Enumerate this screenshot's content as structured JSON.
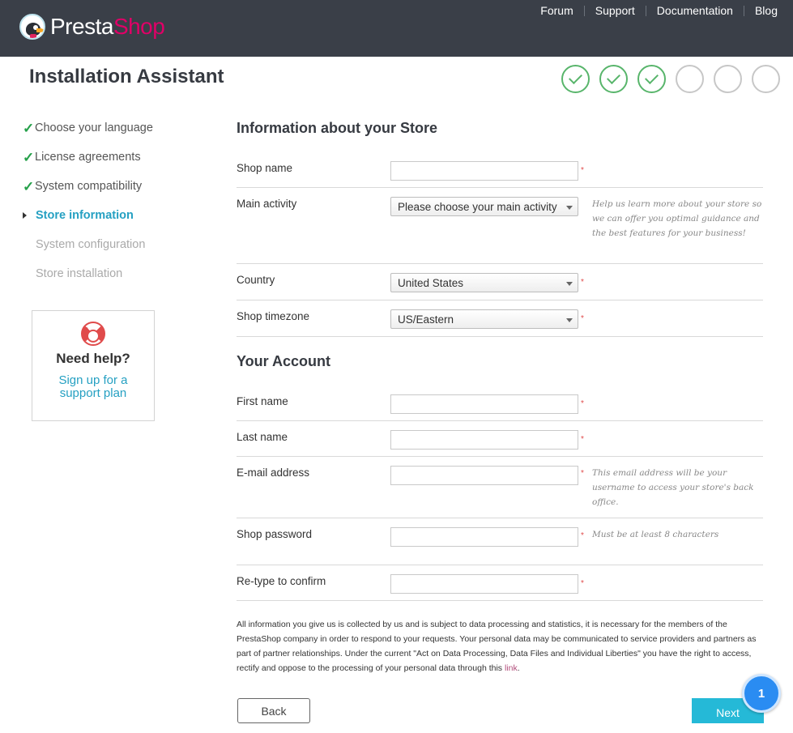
{
  "header": {
    "logo_text_a": "Presta",
    "logo_text_b": "Shop",
    "nav": [
      "Forum",
      "Support",
      "Documentation",
      "Blog"
    ]
  },
  "title": "Installation Assistant",
  "steps": {
    "done": 3,
    "total": 6
  },
  "sidebar": {
    "items": [
      {
        "label": "Choose your language",
        "state": "done"
      },
      {
        "label": "License agreements",
        "state": "done"
      },
      {
        "label": "System compatibility",
        "state": "done"
      },
      {
        "label": "Store information",
        "state": "active"
      },
      {
        "label": "System configuration",
        "state": "todo"
      },
      {
        "label": "Store installation",
        "state": "todo"
      }
    ]
  },
  "help": {
    "title": "Need help?",
    "link": "Sign up for a support plan"
  },
  "store": {
    "section_title": "Information about your Store",
    "shop_name": {
      "label": "Shop name",
      "value": ""
    },
    "main_activity": {
      "label": "Main activity",
      "value": "Please choose your main activity",
      "hint": "Help us learn more about your store so we can offer you optimal guidance and the best features for your business!"
    },
    "country": {
      "label": "Country",
      "value": "United States"
    },
    "timezone": {
      "label": "Shop timezone",
      "value": "US/Eastern"
    }
  },
  "account": {
    "section_title": "Your Account",
    "first_name": {
      "label": "First name",
      "value": ""
    },
    "last_name": {
      "label": "Last name",
      "value": ""
    },
    "email": {
      "label": "E-mail address",
      "value": "",
      "hint": "This email address will be your username to access your store's back office."
    },
    "password": {
      "label": "Shop password",
      "value": "",
      "hint": "Must be at least 8 characters"
    },
    "retype": {
      "label": "Re-type to confirm",
      "value": ""
    }
  },
  "required_mark": "*",
  "legal": {
    "text": "All information you give us is collected by us and is subject to data processing and statistics, it is necessary for the members of the PrestaShop company in order to respond to your requests. Your personal data may be communicated to service providers and partners as part of partner relationships. Under the current \"Act on Data Processing, Data Files and Individual Liberties\" you have the right to access, rectify and oppose to the processing of your personal data through this ",
    "link": "link",
    "end": "."
  },
  "buttons": {
    "back": "Back",
    "next": "Next"
  },
  "notification_count": "1",
  "colors": {
    "header_bg": "#3a3f48",
    "brand_pink": "#df0067",
    "accent_blue": "#25a0c2",
    "next_button": "#25b9d7",
    "step_done": "#58b56b"
  }
}
